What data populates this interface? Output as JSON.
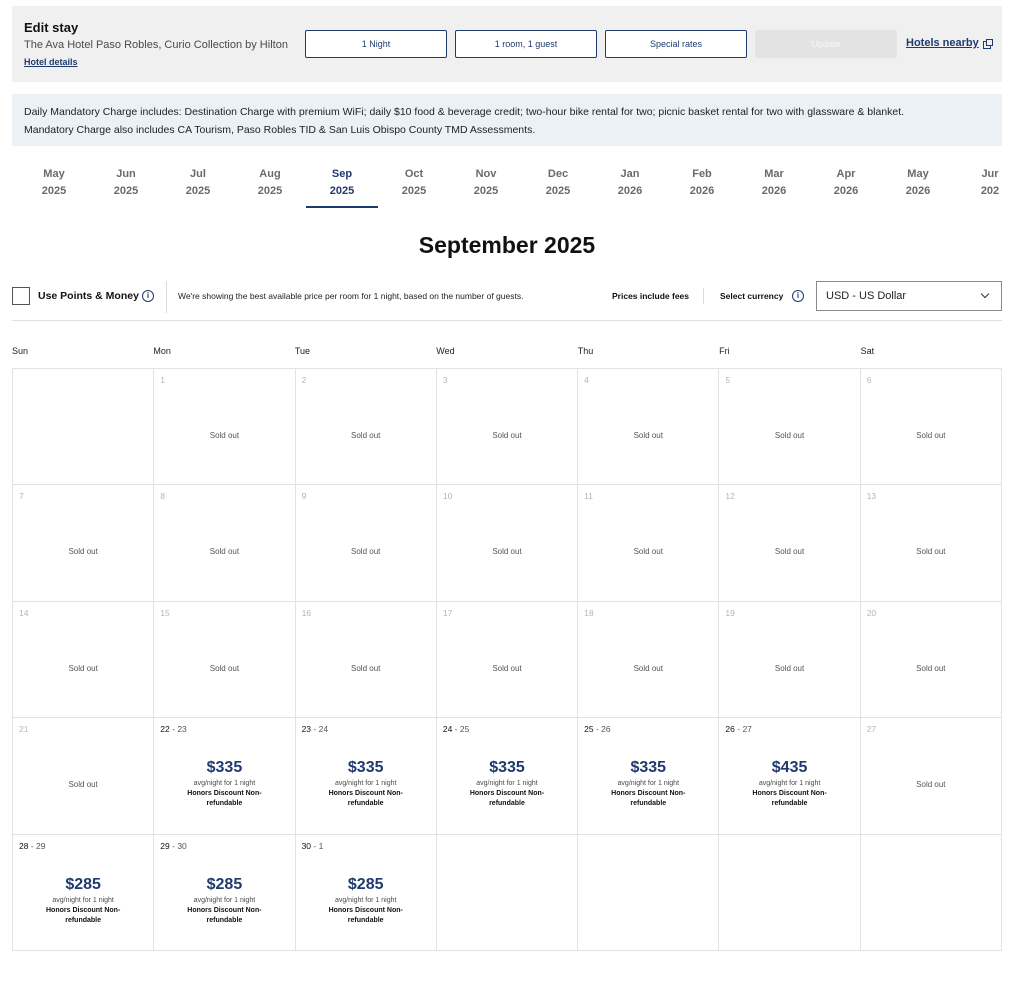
{
  "edit_stay": {
    "title": "Edit stay",
    "hotel_name": "The Ava Hotel Paso Robles, Curio Collection by Hilton",
    "hotel_details": "Hotel details",
    "nights": "1 Night",
    "rooms": "1 room, 1 guest",
    "special_rates": "Special rates",
    "update": "Update",
    "hotels_nearby": "Hotels nearby"
  },
  "notice": {
    "line1": "Daily Mandatory Charge includes: Destination Charge with premium WiFi; daily $10 food & beverage credit; two-hour bike rental for two; picnic basket rental for two with glassware & blanket.",
    "line2": "Mandatory Charge also includes CA Tourism, Paso Robles TID & San Luis Obispo County TMD Assessments."
  },
  "months": [
    {
      "month": "May",
      "year": "2025"
    },
    {
      "month": "Jun",
      "year": "2025"
    },
    {
      "month": "Jul",
      "year": "2025"
    },
    {
      "month": "Aug",
      "year": "2025"
    },
    {
      "month": "Sep",
      "year": "2025"
    },
    {
      "month": "Oct",
      "year": "2025"
    },
    {
      "month": "Nov",
      "year": "2025"
    },
    {
      "month": "Dec",
      "year": "2025"
    },
    {
      "month": "Jan",
      "year": "2026"
    },
    {
      "month": "Feb",
      "year": "2026"
    },
    {
      "month": "Mar",
      "year": "2026"
    },
    {
      "month": "Apr",
      "year": "2026"
    },
    {
      "month": "May",
      "year": "2026"
    },
    {
      "month": "Jur",
      "year": "202"
    }
  ],
  "active_month_index": 4,
  "calendar_title": "September 2025",
  "options": {
    "use_points": "Use Points & Money",
    "info_glyph": "i",
    "best_price": "We're showing the best available price per room for 1 night, based on the number of guests.",
    "prices_include_fees": "Prices include fees",
    "select_currency": "Select currency",
    "currency_value": "USD - US Dollar"
  },
  "weekdays": [
    "Sun",
    "Mon",
    "Tue",
    "Wed",
    "Thu",
    "Fri",
    "Sat"
  ],
  "colors": {
    "accent": "#1f3a6e",
    "bar_bg": "#f0f0f0",
    "notice_bg": "#ebf1f5"
  },
  "days": [
    {
      "day": "",
      "status": "empty"
    },
    {
      "day": "1",
      "status": "Sold out"
    },
    {
      "day": "2",
      "status": "Sold out"
    },
    {
      "day": "3",
      "status": "Sold out"
    },
    {
      "day": "4",
      "status": "Sold out"
    },
    {
      "day": "5",
      "status": "Sold out"
    },
    {
      "day": "6",
      "status": "Sold out"
    },
    {
      "day": "7",
      "status": "Sold out"
    },
    {
      "day": "8",
      "status": "Sold out"
    },
    {
      "day": "9",
      "status": "Sold out"
    },
    {
      "day": "10",
      "status": "Sold out"
    },
    {
      "day": "11",
      "status": "Sold out"
    },
    {
      "day": "12",
      "status": "Sold out"
    },
    {
      "day": "13",
      "status": "Sold out"
    },
    {
      "day": "14",
      "status": "Sold out"
    },
    {
      "day": "15",
      "status": "Sold out"
    },
    {
      "day": "16",
      "status": "Sold out"
    },
    {
      "day": "17",
      "status": "Sold out"
    },
    {
      "day": "18",
      "status": "Sold out"
    },
    {
      "day": "19",
      "status": "Sold out"
    },
    {
      "day": "20",
      "status": "Sold out"
    },
    {
      "day": "21",
      "status": "Sold out"
    },
    {
      "day": "22",
      "next": "23",
      "price": "$335",
      "avg": "avg/night for 1 night",
      "rate": "Honors Discount Non-refundable"
    },
    {
      "day": "23",
      "next": "24",
      "price": "$335",
      "avg": "avg/night for 1 night",
      "rate": "Honors Discount Non-refundable"
    },
    {
      "day": "24",
      "next": "25",
      "price": "$335",
      "avg": "avg/night for 1 night",
      "rate": "Honors Discount Non-refundable"
    },
    {
      "day": "25",
      "next": "26",
      "price": "$335",
      "avg": "avg/night for 1 night",
      "rate": "Honors Discount Non-refundable"
    },
    {
      "day": "26",
      "next": "27",
      "price": "$435",
      "avg": "avg/night for 1 night",
      "rate": "Honors Discount Non-refundable"
    },
    {
      "day": "27",
      "status": "Sold out"
    },
    {
      "day": "28",
      "next": "29",
      "price": "$285",
      "avg": "avg/night for 1 night",
      "rate": "Honors Discount Non-refundable"
    },
    {
      "day": "29",
      "next": "30",
      "price": "$285",
      "avg": "avg/night for 1 night",
      "rate": "Honors Discount Non-refundable"
    },
    {
      "day": "30",
      "next": "1",
      "price": "$285",
      "avg": "avg/night for 1 night",
      "rate": "Honors Discount Non-refundable"
    },
    {
      "day": "",
      "status": "empty"
    },
    {
      "day": "",
      "status": "empty"
    },
    {
      "day": "",
      "status": "empty"
    },
    {
      "day": "",
      "status": "empty"
    }
  ]
}
